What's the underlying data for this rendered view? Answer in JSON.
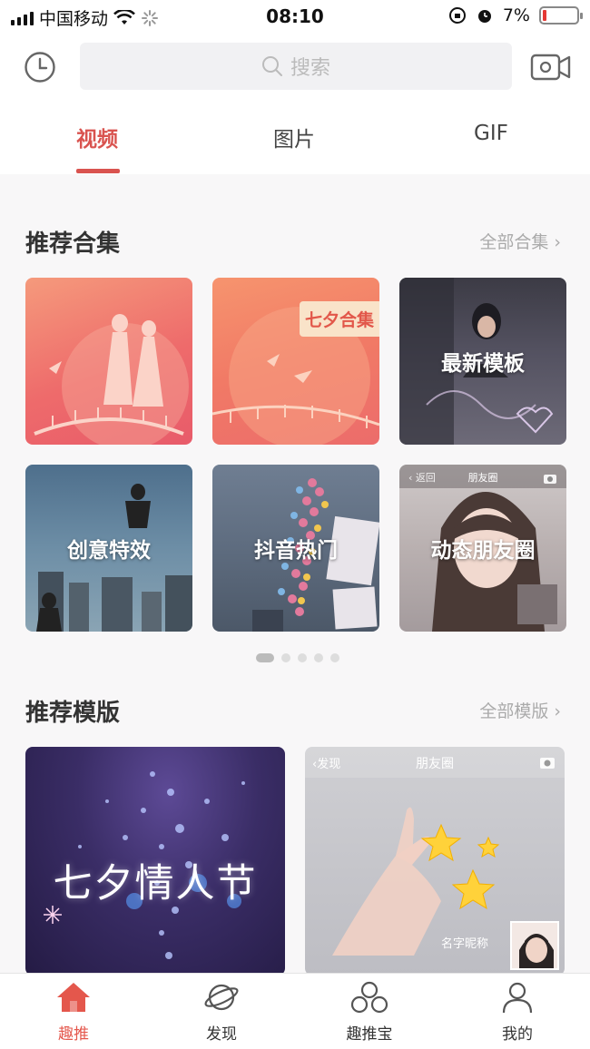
{
  "status_bar": {
    "carrier": "中国移动",
    "time": "08:10",
    "battery": "7%"
  },
  "header": {
    "search_placeholder": "搜索",
    "tabs": [
      {
        "label": "视频",
        "active": true
      },
      {
        "label": "图片",
        "active": false
      },
      {
        "label": "GIF",
        "active": false
      }
    ]
  },
  "collections": {
    "title": "推荐合集",
    "more": "全部合集",
    "cards": [
      {
        "label": "",
        "name": "qixi-silhouette"
      },
      {
        "label": "七夕合集",
        "name": "qixi-collection"
      },
      {
        "label": "最新模板"
      },
      {
        "label": "创意特效"
      },
      {
        "label": "抖音热门"
      },
      {
        "label": "动态朋友圈"
      }
    ],
    "pager": {
      "pages": 5,
      "current": 1
    }
  },
  "templates": {
    "title": "推荐模版",
    "more": "全部模版",
    "items": [
      {
        "label": "七夕情人节"
      },
      {
        "back": "发现",
        "title": "朋友圈",
        "caption": "名字昵称"
      }
    ]
  },
  "cards_small_text": {
    "moments_title": "朋友圈",
    "moments_back": "返回"
  },
  "bottom_nav": [
    {
      "label": "趣推",
      "active": true
    },
    {
      "label": "发现",
      "active": false
    },
    {
      "label": "趣推宝",
      "active": false
    },
    {
      "label": "我的",
      "active": false
    }
  ],
  "colors": {
    "accent": "#d9534f",
    "nav_active": "#e4574c"
  }
}
